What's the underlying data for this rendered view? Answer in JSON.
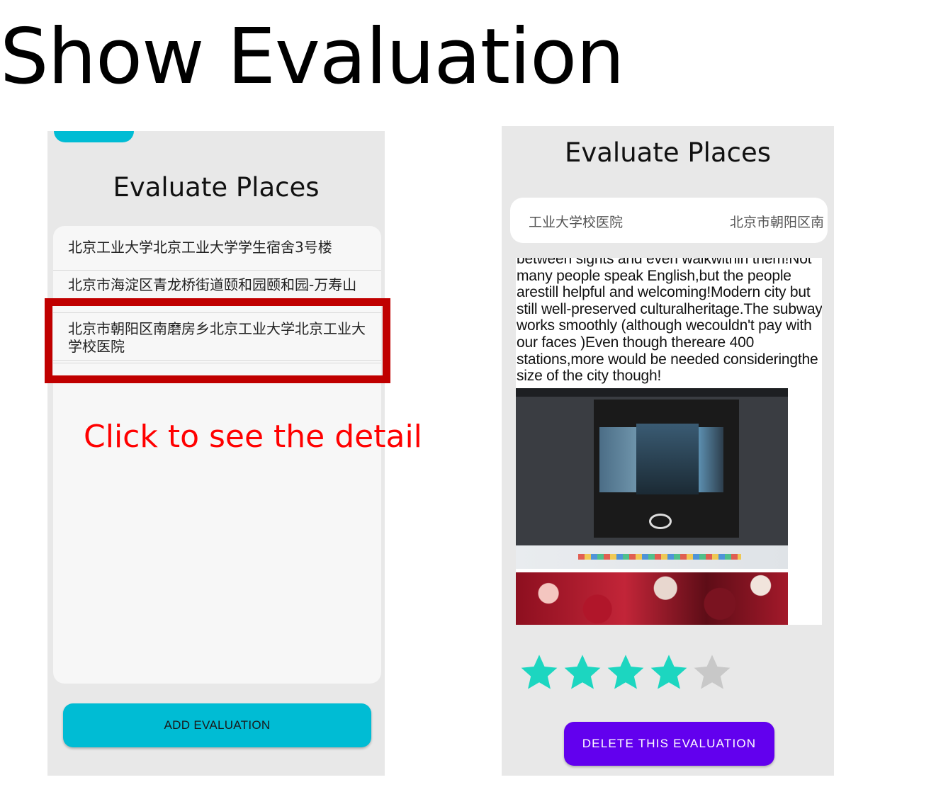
{
  "slide": {
    "title": "Show Evaluation"
  },
  "left_screen": {
    "title": "Evaluate Places",
    "places": [
      "北京工业大学北京工业大学学生宿舍3号楼",
      "北京市海淀区青龙桥街道颐和园颐和园-万寿山",
      "北京市朝阳区南磨房乡北京工业大学北京工业大学校医院"
    ],
    "add_button": "ADD EVALUATION"
  },
  "annotation": {
    "hint": "Click to see the detail",
    "color": "#c00000"
  },
  "right_screen": {
    "title": "Evaluate Places",
    "place_name_fragment": "工业大学校医院",
    "place_address_fragment": "北京市朝阳区南",
    "review_text": "between sights and even walkwithin them!Not many people speak English,but the people arestill helpful and welcoming!Modern city but still well-preserved culturalheritage.The subway works smoothly (although wecouldn't pay with our faces )Even though thereare 400 stations,more would be needed consideringthe size of the city though!",
    "rating": 4,
    "rating_max": 5,
    "delete_button": "DELETE THIS EVALUATION"
  },
  "colors": {
    "accent_teal": "#00bcd4",
    "star_filled": "#1cd6c0",
    "star_empty": "#c8c8c8",
    "delete_purple": "#6200ee",
    "hint_red": "#ff0000"
  }
}
